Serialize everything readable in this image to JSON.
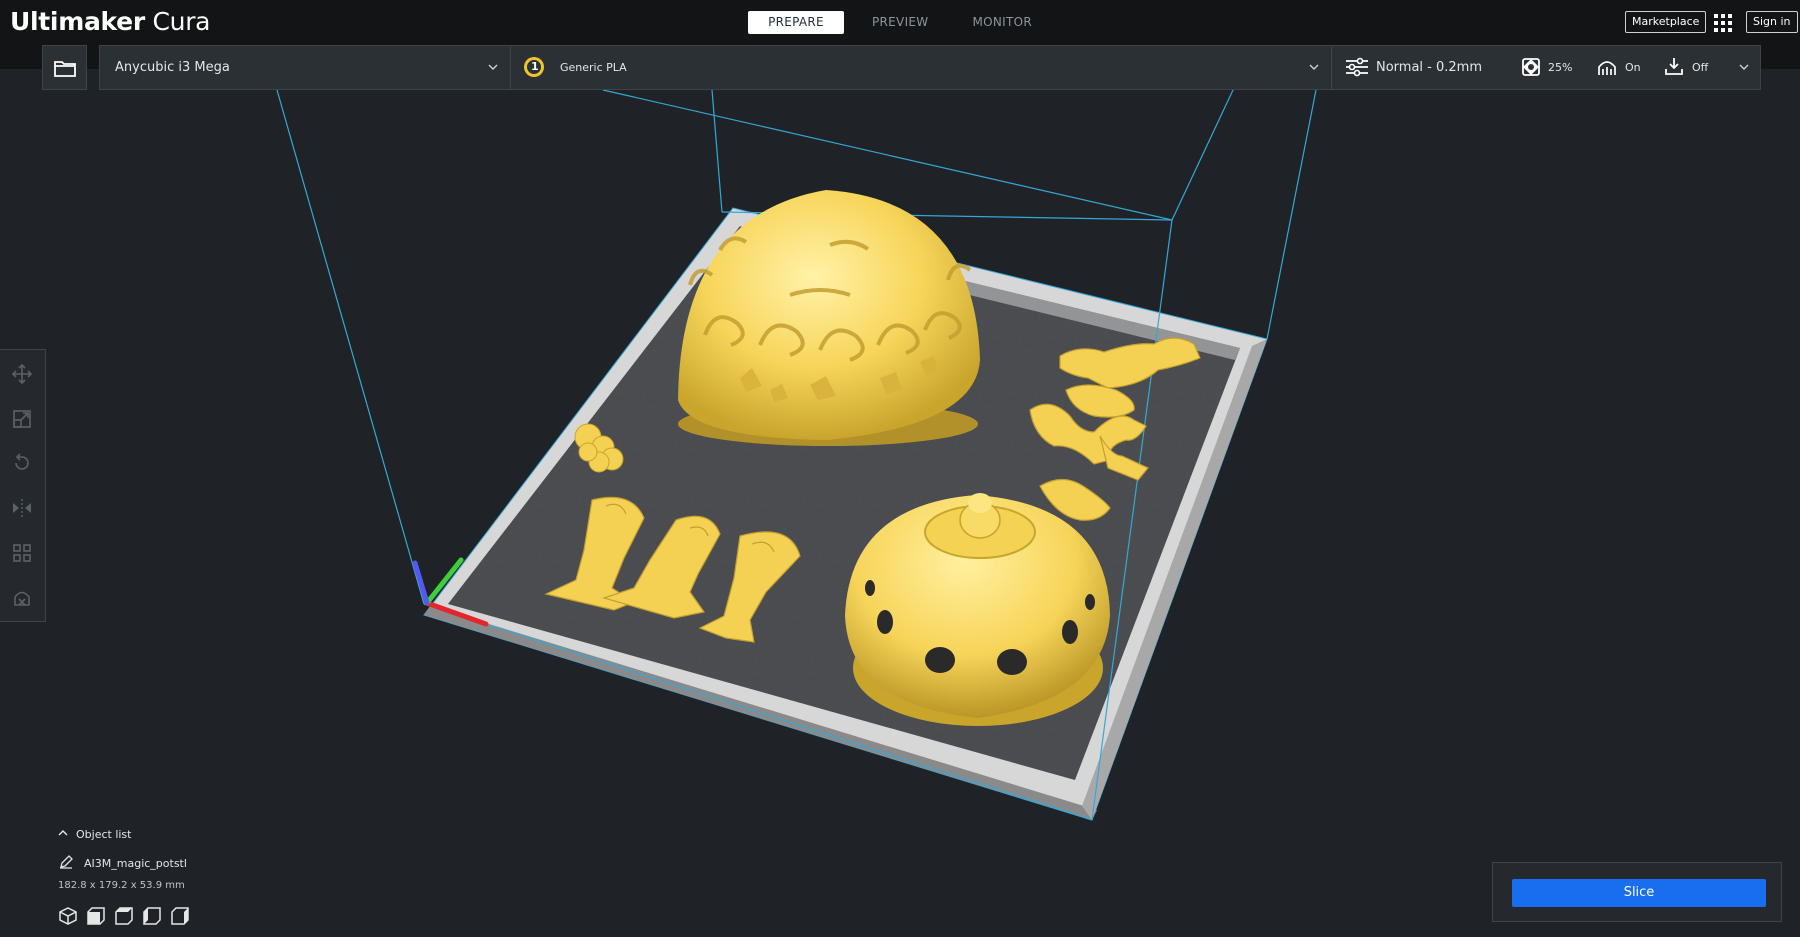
{
  "app": {
    "logo_bold": "Ultimaker",
    "logo_light": " Cura"
  },
  "stages": [
    {
      "label": "PREPARE",
      "active": true
    },
    {
      "label": "PREVIEW",
      "active": false
    },
    {
      "label": "MONITOR",
      "active": false
    }
  ],
  "header": {
    "marketplace": "Marketplace",
    "signin": "Sign in"
  },
  "toolbar": {
    "printer": "Anycubic i3 Mega",
    "extruder_number": "1",
    "material": "Generic PLA",
    "profile": "Normal - 0.2mm",
    "infill": "25%",
    "support": "On",
    "adhesion": "Off"
  },
  "object_list": {
    "toggle_label": "Object list",
    "object_name": "AI3M_magic_potstl",
    "dimensions": "182.8 x 179.2 x 53.9 mm"
  },
  "slice": {
    "label": "Slice"
  },
  "colors": {
    "accent": "#196ef0",
    "model": "#f7d55a",
    "background": "#1f2328",
    "header": "#121416",
    "build_volume_lines": "#37a7d6",
    "axis_x": "#e3262b",
    "axis_y": "#3fcf3a",
    "axis_z": "#5659f0"
  },
  "icons": {
    "folder": "folder-icon",
    "chevron": "chevron-down-icon",
    "apps": "grid-apps-icon",
    "profile": "sliders-icon",
    "infill": "infill-icon",
    "support": "support-icon",
    "adhesion": "adhesion-icon",
    "tools": [
      "move-icon",
      "scale-icon",
      "rotate-icon",
      "mirror-icon",
      "per-model-settings-icon",
      "support-blocker-icon"
    ],
    "views": [
      "view-3d-icon",
      "view-front-icon",
      "view-top-icon",
      "view-left-icon",
      "view-right-icon"
    ]
  }
}
